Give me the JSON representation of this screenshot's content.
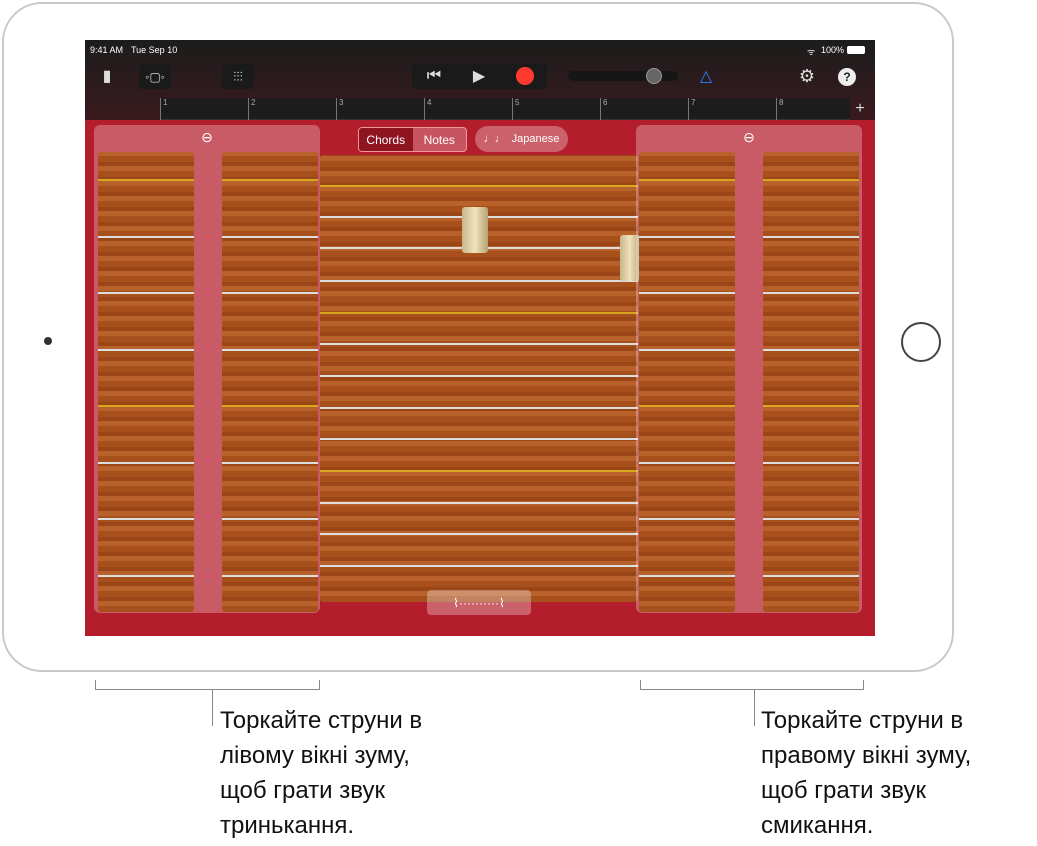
{
  "status": {
    "time": "9:41 AM",
    "date": "Tue Sep 10",
    "battery": "100%"
  },
  "toolbar": {
    "icons": [
      "document-icon",
      "tracks-view-icon",
      "mixer-icon",
      "rewind-icon",
      "play-icon",
      "record-icon",
      "metronome-icon",
      "settings-icon",
      "help-icon"
    ],
    "play": "▶",
    "rewind": "⏮",
    "help": "?",
    "settings": "⚙",
    "add": "+"
  },
  "ruler": {
    "bars": [
      "1",
      "2",
      "3",
      "4",
      "5",
      "6",
      "7",
      "8"
    ]
  },
  "controls": {
    "chords": "Chords",
    "notes": "Notes",
    "scale": "Japanese",
    "scale_icon": "♩♩",
    "zoom_out": "⊖",
    "glissando": "⌇··········⌇"
  },
  "colors": {
    "felt": "#b31d2c",
    "record": "#ff3b30",
    "metronome": "#2a7fff",
    "gold_string": "#d9a620"
  },
  "callouts": {
    "left": "Торкайте струни в\nлівому вікні зуму,\nщоб грати звук\nтринькання.",
    "right": "Торкайте струни в\nправому вікні зуму,\nщоб грати звук\nсмикання."
  }
}
